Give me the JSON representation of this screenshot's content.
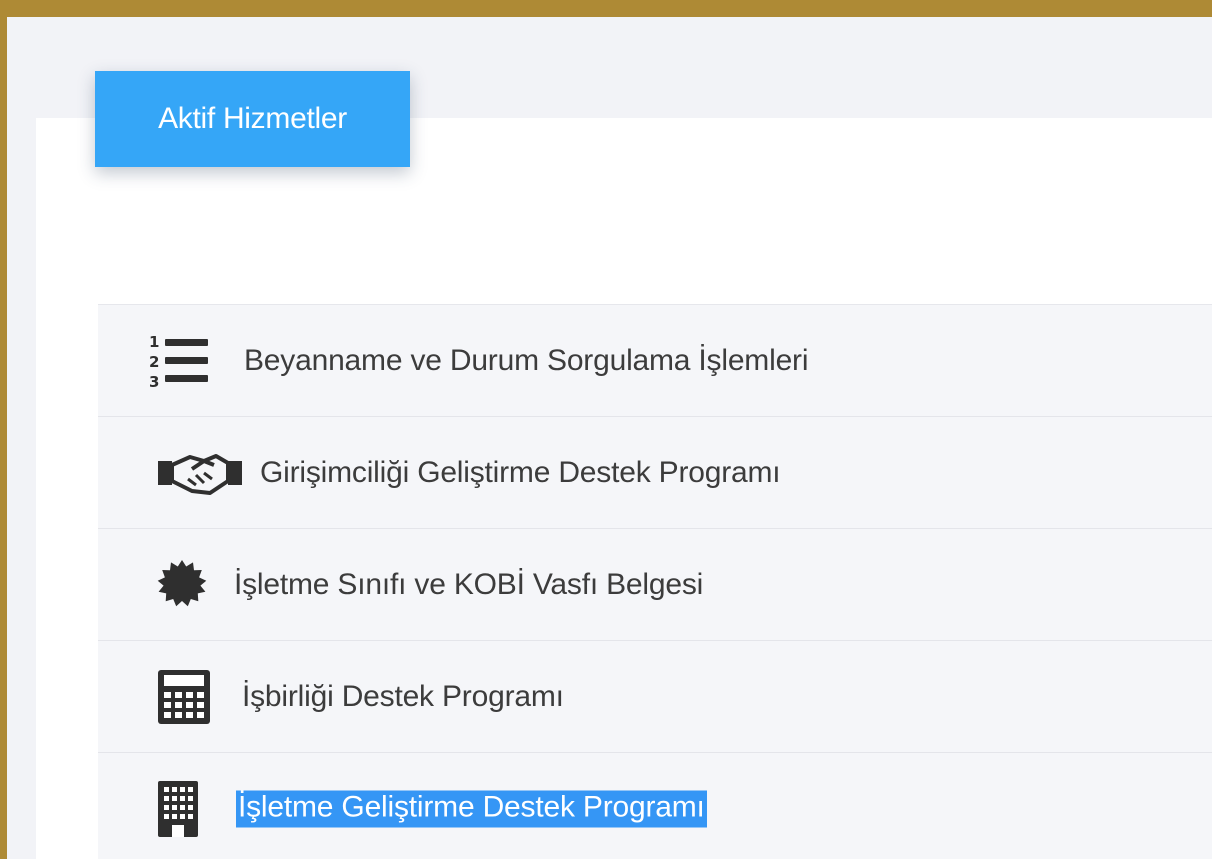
{
  "tab": {
    "label": "Aktif Hizmetler"
  },
  "services": [
    {
      "label": "Beyanname ve Durum Sorgulama İşlemleri",
      "icon": "numbered-list-icon"
    },
    {
      "label": "Girişimciliği Geliştirme Destek Programı",
      "icon": "handshake-icon"
    },
    {
      "label": "İşletme Sınıfı ve KOBİ Vasfı Belgesi",
      "icon": "certificate-icon"
    },
    {
      "label": "İşbirliği Destek Programı",
      "icon": "calculator-icon"
    },
    {
      "label": "İşletme Geliştirme Destek Programı",
      "icon": "building-icon",
      "selected": true
    }
  ],
  "colors": {
    "background": "#ae8a35",
    "tab": "#35a6f7",
    "selection": "#3596f5",
    "icon": "#2f2f2f"
  }
}
